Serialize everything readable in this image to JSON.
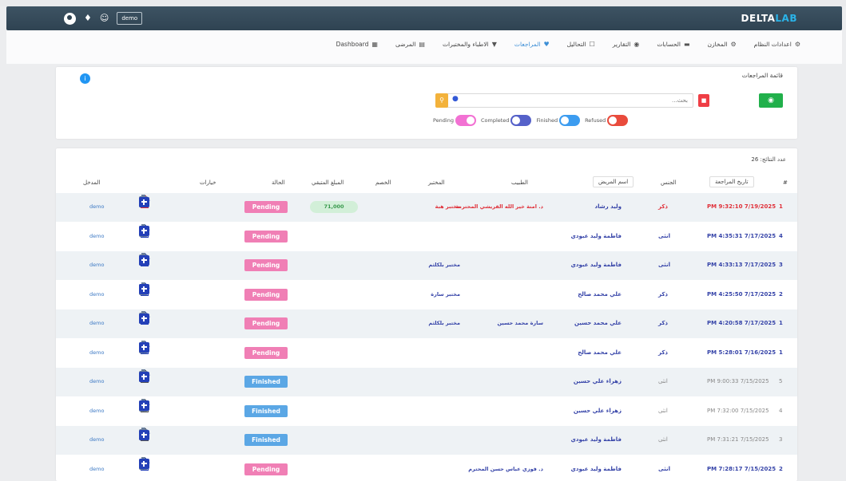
{
  "topbar": {
    "user_label": "demo",
    "brand_main": "DELTA",
    "brand_accent": "LAB",
    "icons": [
      "globe-icon",
      "bell-icon",
      "user-icon"
    ]
  },
  "nav": [
    {
      "label": "Dashboard",
      "icon": "dashboard-icon",
      "active": false
    },
    {
      "label": "المرضى",
      "icon": "bed-icon",
      "active": false
    },
    {
      "label": "الاطباء والمختبرات",
      "icon": "doctor-icon",
      "active": false
    },
    {
      "label": "المراجعات",
      "icon": "heart-icon",
      "active": true
    },
    {
      "label": "التحاليل",
      "icon": "flask-icon",
      "active": false
    },
    {
      "label": "التقارير",
      "icon": "report-icon",
      "active": false
    },
    {
      "label": "الحسابات",
      "icon": "money-icon",
      "active": false
    },
    {
      "label": "المخازن",
      "icon": "store-icon",
      "active": false
    },
    {
      "label": "اعدادات النظام",
      "icon": "gear-icon",
      "active": false
    }
  ],
  "search_panel": {
    "title": "قائمة المراجعات",
    "search_placeholder": "بحث...",
    "filters": [
      {
        "label": "Pending",
        "state": "on"
      },
      {
        "label": "Completed",
        "state": "off"
      },
      {
        "label": "Finished",
        "state": "off"
      },
      {
        "label": "Refused",
        "state": "off"
      }
    ]
  },
  "table": {
    "count_label": "عدد النتائج: 26",
    "headers": {
      "num": "#",
      "date": "تاريخ المراجعة",
      "gender": "الجنس",
      "patient": "اسم المريض",
      "doctor": "الطبيب",
      "lab": "المختبر",
      "discount": "الخصم",
      "remaining": "المبلغ المتبقي",
      "status": "الحالة",
      "options": "خيارات",
      "user": "المدخل"
    },
    "rows": [
      {
        "num": "1",
        "date": "PM 9:32:10 7/19/2025",
        "gender": "ذكر",
        "patient": "وليد رشاد",
        "doctor": "د. امنة خير الله القريشي المحترمة",
        "lab": "مختبر هبة",
        "amount": "71,000",
        "status": "Pending",
        "user": "demo",
        "tone": "red"
      },
      {
        "num": "4",
        "date": "PM 4:35:31 7/17/2025",
        "gender": "انثى",
        "patient": "فاطمة وليد عبودي",
        "doctor": "",
        "lab": "",
        "amount": "",
        "status": "Pending",
        "user": "demo",
        "tone": "blue"
      },
      {
        "num": "3",
        "date": "PM 4:33:13 7/17/2025",
        "gender": "انثى",
        "patient": "فاطمة وليد عبودي",
        "doctor": "",
        "lab": "مختبر بلكلثم",
        "amount": "",
        "status": "Pending",
        "user": "demo",
        "tone": "blue"
      },
      {
        "num": "2",
        "date": "PM 4:25:50 7/17/2025",
        "gender": "ذكر",
        "patient": "علي محمد صالح",
        "doctor": "",
        "lab": "مختبر سارة",
        "amount": "",
        "status": "Pending",
        "user": "demo",
        "tone": "blue"
      },
      {
        "num": "1",
        "date": "PM 4:20:58 7/17/2025",
        "gender": "ذكر",
        "patient": "علي محمد حسين",
        "doctor": "سارة محمد حسين",
        "lab": "مختبر بلكلثم",
        "amount": "",
        "status": "Pending",
        "user": "demo",
        "tone": "blue"
      },
      {
        "num": "1",
        "date": "PM 5:28:01 7/16/2025",
        "gender": "ذكر",
        "patient": "علي محمد صالح",
        "doctor": "",
        "lab": "",
        "amount": "",
        "status": "Pending",
        "user": "demo",
        "tone": "blue"
      },
      {
        "num": "5",
        "date": "PM 9:00:33 7/15/2025",
        "gender": "انثى",
        "patient": "زهراء علي حسين",
        "doctor": "",
        "lab": "",
        "amount": "",
        "status": "Finished",
        "user": "demo",
        "tone": "grey"
      },
      {
        "num": "4",
        "date": "PM 7:32:00 7/15/2025",
        "gender": "انثى",
        "patient": "زهراء علي حسين",
        "doctor": "",
        "lab": "",
        "amount": "",
        "status": "Finished",
        "user": "demo",
        "tone": "grey"
      },
      {
        "num": "3",
        "date": "PM 7:31:21 7/15/2025",
        "gender": "انثى",
        "patient": "فاطمة وليد عبودي",
        "doctor": "",
        "lab": "",
        "amount": "",
        "status": "Finished",
        "user": "demo",
        "tone": "grey"
      },
      {
        "num": "2",
        "date": "PM 7:28:17 7/15/2025",
        "gender": "انثى",
        "patient": "فاطمة وليد عبودي",
        "doctor": "د. فوزي عباس حسن المحترم",
        "lab": "",
        "amount": "",
        "status": "Pending",
        "user": "demo",
        "tone": "blue"
      }
    ]
  },
  "colors": {
    "topbar": "#2f4352",
    "brand_accent": "#2ab3e8",
    "pending": "#f07fb5",
    "finished": "#5ba7e5",
    "row_blue": "#3543a8",
    "row_red": "#e0313a"
  }
}
